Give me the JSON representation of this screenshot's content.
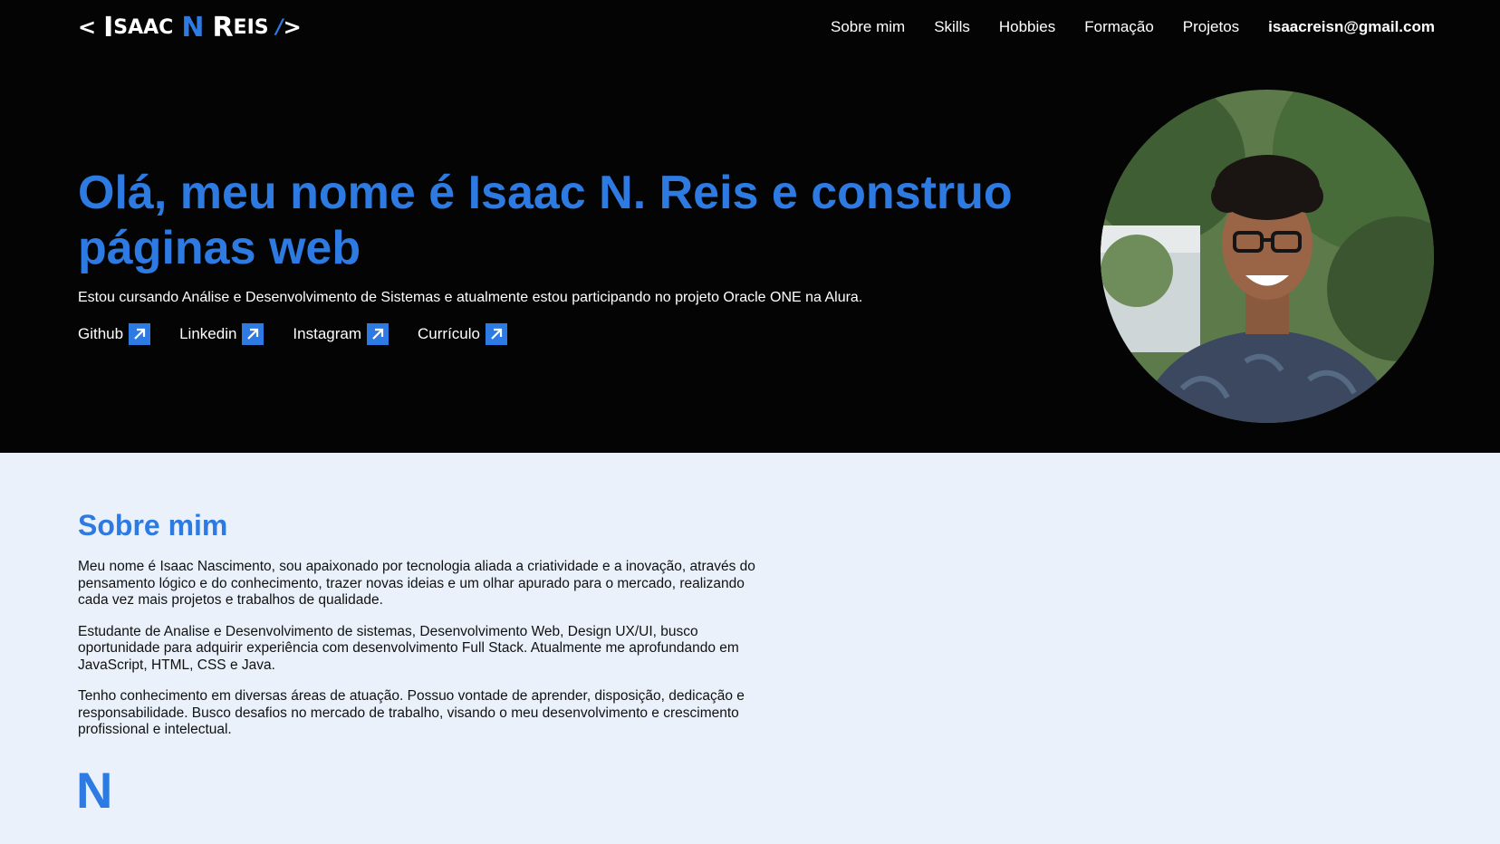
{
  "logo": {
    "open": "<",
    "first_initial": "I",
    "first_rest": "SAAC",
    "middle": "N",
    "last_initial": "R",
    "last_rest": "EIS",
    "slash": "/",
    "close": ">"
  },
  "nav": {
    "items": [
      "Sobre mim",
      "Skills",
      "Hobbies",
      "Formação",
      "Projetos"
    ],
    "email": "isaacreisn@gmail.com"
  },
  "hero": {
    "title": "Olá, meu nome é Isaac N. Reis e construo páginas web",
    "subtitle": "Estou cursando Análise e Desenvolvimento de Sistemas e atualmente estou participando no projeto Oracle ONE na Alura.",
    "links": [
      "Github",
      "Linkedin",
      "Instagram",
      "Currículo"
    ],
    "link_icon": "external-link-arrow-icon"
  },
  "about": {
    "title": "Sobre mim",
    "paragraphs": [
      "Meu nome é Isaac Nascimento, sou apaixonado por tecnologia aliada a criatividade e a inovação, através do pensamento lógico e do conhecimento, trazer novas ideias e um olhar apurado para o mercado, realizando cada vez mais projetos e trabalhos de qualidade.",
      "Estudante de Analise e Desenvolvimento de sistemas, Desenvolvimento Web, Design UX/UI, busco oportunidade para adquirir experiência com desenvolvimento Full Stack. Atualmente me aprofundando em JavaScript, HTML, CSS e Java.",
      "Tenho conhecimento em diversas áreas de atuação. Possuo vontade de aprender, disposição, dedicação e responsabilidade. Busco desafios no mercado de trabalho, visando o meu desenvolvimento e crescimento profissional e intelectual."
    ],
    "logo_letter": "N"
  },
  "colors": {
    "accent": "#2d7be2",
    "hero_bg": "#040404",
    "about_bg": "#eaf1fb"
  }
}
